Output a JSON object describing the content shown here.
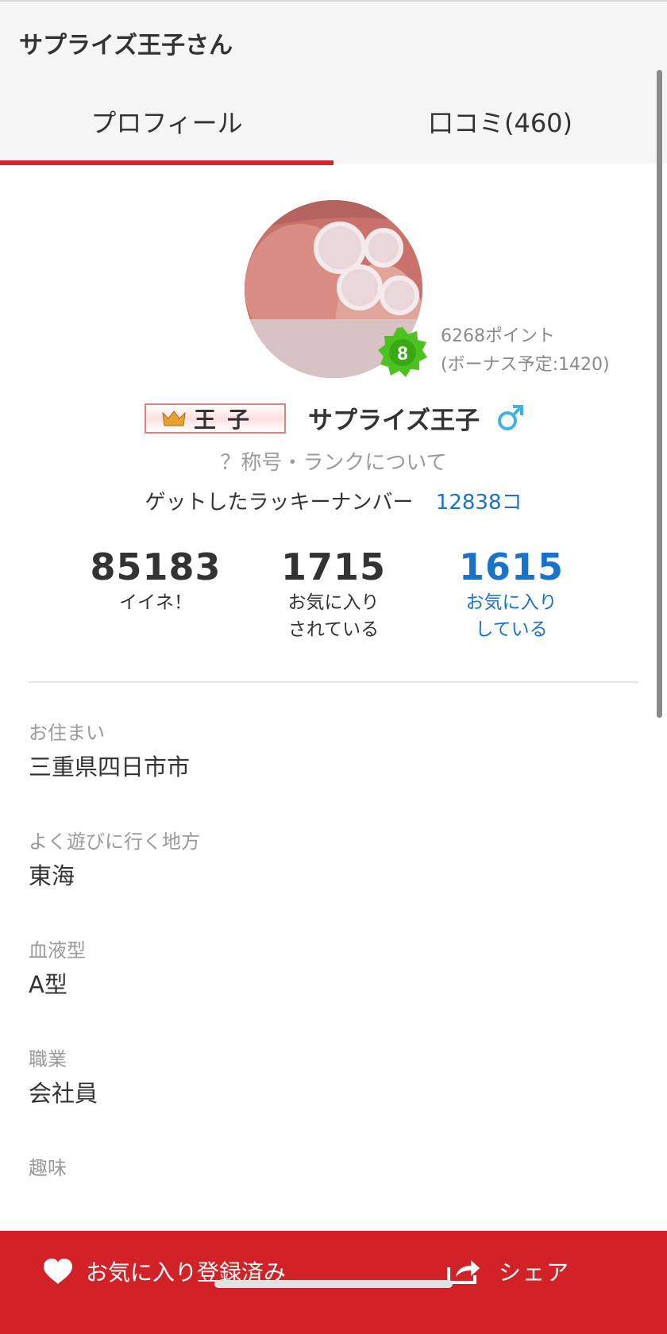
{
  "header": {
    "title": "サプライズ王子さん"
  },
  "tabs": [
    {
      "label": "プロフィール",
      "active": true
    },
    {
      "label": "口コミ(460)",
      "active": false
    }
  ],
  "profile": {
    "rank_level": "8",
    "points": "6268ポイント",
    "bonus": "(ボーナス予定:1420)",
    "title_plate": "王子",
    "name": "サプライズ王子",
    "gender_symbol": "♂",
    "rank_link": "？称号・ランクについて",
    "lucky_label": "ゲットしたラッキーナンバー",
    "lucky_value": "12838コ"
  },
  "stats": [
    {
      "value": "85183",
      "label": "イイネ！"
    },
    {
      "value": "1715",
      "label": "お気に入り\nされている"
    },
    {
      "value": "1615",
      "label": "お気に入り\nしている"
    }
  ],
  "fields": [
    {
      "label": "お住まい",
      "value": "三重県四日市市"
    },
    {
      "label": "よく遊びに行く地方",
      "value": "東海"
    },
    {
      "label": "血液型",
      "value": "A型"
    },
    {
      "label": "職業",
      "value": "会社員"
    },
    {
      "label": "趣味",
      "value": ""
    }
  ],
  "bottom_bar": {
    "favorite_label": "お気に入り登録済み",
    "share_label": "シェア"
  },
  "colors": {
    "accent_red": "#d12227",
    "link_blue": "#1a73c9",
    "rank_green": "#4cc21f",
    "gender_blue": "#3fb2e6"
  }
}
